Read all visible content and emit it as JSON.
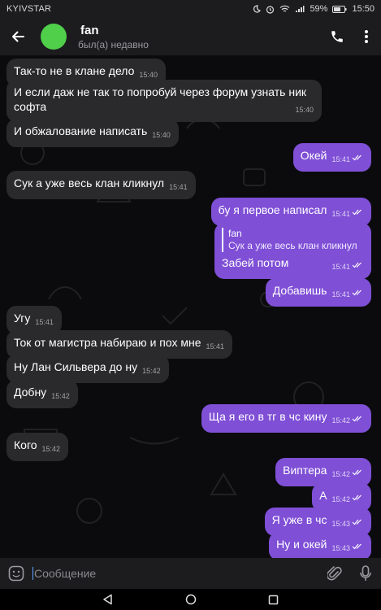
{
  "status": {
    "carrier": "KYIVSTAR",
    "battery": "59%",
    "time": "15:50"
  },
  "header": {
    "name": "fan",
    "last_seen": "был(а) недавно",
    "avatar_color": "#4fcf4a"
  },
  "colors": {
    "outgoing": "#7f4fd6",
    "incoming": "#2a2a2d"
  },
  "messages": [
    {
      "text": "Так-то не в клане дело",
      "time": "15:40"
    },
    {
      "text": "И если даж не так то попробуй через форум узнать ник",
      "text2": "софта",
      "time": "15:40"
    },
    {
      "text": "И обжалование написать",
      "time": "15:40"
    },
    {
      "text": "Окей",
      "time": "15:41"
    },
    {
      "text": "Сук а уже весь клан кликнул",
      "time": "15:41"
    },
    {
      "text": "бу я первое написал",
      "time": "15:41"
    },
    {
      "reply_name": "fan",
      "reply_text": "Сук а уже весь клан кликнул",
      "text": "Забей потом",
      "time": "15:41"
    },
    {
      "text": "Добавишь",
      "time": "15:41"
    },
    {
      "text": "Угу",
      "time": "15:41"
    },
    {
      "text": "Ток от магистра набираю и пох мне",
      "time": "15:41"
    },
    {
      "text": "Ну Лан Сильвера до ну",
      "time": "15:42"
    },
    {
      "text": "Добну",
      "time": "15:42"
    },
    {
      "text": "Ща я его в тг в чс кину",
      "time": "15:42"
    },
    {
      "text": "Кого",
      "time": "15:42"
    },
    {
      "text": "Виптера",
      "time": "15:42"
    },
    {
      "text": "А",
      "time": "15:42"
    },
    {
      "text": "Я уже в чс",
      "time": "15:43"
    },
    {
      "text": "Ну и окей",
      "time": "15:43"
    }
  ],
  "input": {
    "placeholder": "Сообщение"
  },
  "icons": [
    "back-arrow-icon",
    "phone-icon",
    "more-vert-icon",
    "emoji-icon",
    "attach-icon",
    "mic-icon",
    "nav-back-icon",
    "nav-home-icon",
    "nav-recents-icon"
  ]
}
